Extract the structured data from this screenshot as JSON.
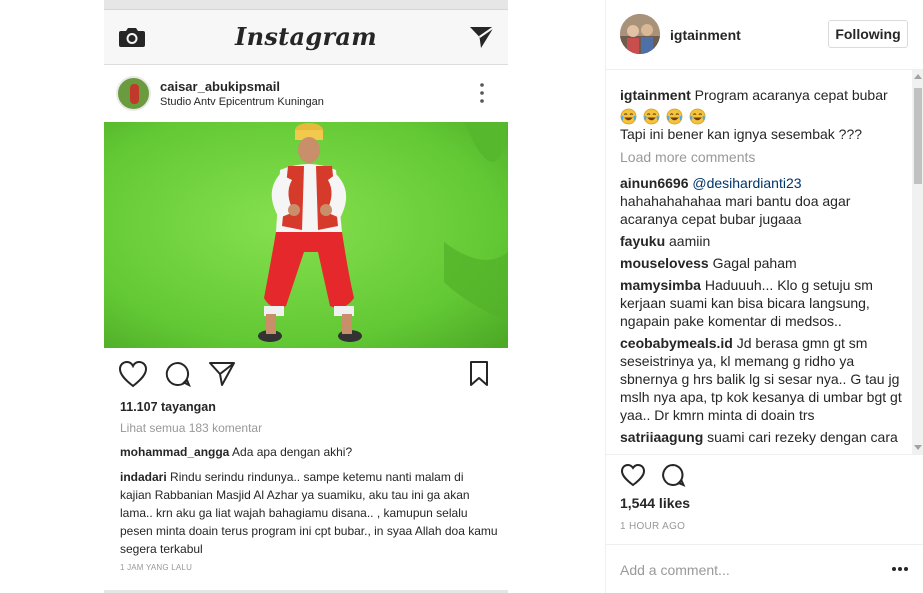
{
  "embedded_post": {
    "app_title": "Instagram",
    "username": "caisar_abukipsmail",
    "location": "Studio Antv Epicentrum Kuningan",
    "views": "11.107 tayangan",
    "view_all_comments": "Lihat semua 183 komentar",
    "comments": [
      {
        "user": "mohammad_angga",
        "text": "Ada apa dengan akhi?"
      },
      {
        "user": "indadari",
        "text": "Rindu serindu rindunya.. sampe ketemu nanti malam di kajian Rabbanian Masjid Al Azhar ya suamiku, aku tau ini ga akan lama.. krn aku ga liat wajah bahagiamu disana.. , kamupun selalu pesen minta doain terus program ini cpt bubar., in syaa Allah doa kamu segera terkabul"
      }
    ],
    "timestamp": "1 JAM YANG LALU"
  },
  "panel": {
    "header": {
      "username": "igtainment",
      "follow_button": "Following"
    },
    "caption": {
      "user": "igtainment",
      "text": "Program acaranya cepat bubar",
      "emoji_count": 4,
      "second_line": "Tapi ini bener kan ignya sesembak ???"
    },
    "load_more": "Load more comments",
    "comments": [
      {
        "user": "ainun6696",
        "mention": "@desihardianti23",
        "text": "hahahahahahaa mari bantu doa agar acaranya cepat bubar jugaaa"
      },
      {
        "user": "fayuku",
        "text": "aamiin"
      },
      {
        "user": "mouselovess",
        "text": "Gagal paham"
      },
      {
        "user": "mamysimba",
        "text": "Haduuuh... Klo g setuju sm kerjaan suami kan bisa bicara langsung, ngapain pake komentar di medsos.."
      },
      {
        "user": "ceobabymeals.id",
        "text": "Jd berasa gmn gt sm seseistrinya ya, kl memang g ridho ya sbnernya g hrs balik lg si sesar nya.. G tau jg mslh nya apa, tp kok kesanya di umbar bgt gt yaa.. Dr kmrn minta di doain trs"
      },
      {
        "user": "satriiaagung",
        "text": "suami cari rezeky dengan cara"
      }
    ],
    "likes": "1,544 likes",
    "time": "1 HOUR AGO",
    "add_comment_placeholder": "Add a comment...",
    "icons": {
      "like": "heart-icon",
      "comment": "comment-icon",
      "more": "more-options-icon"
    }
  }
}
